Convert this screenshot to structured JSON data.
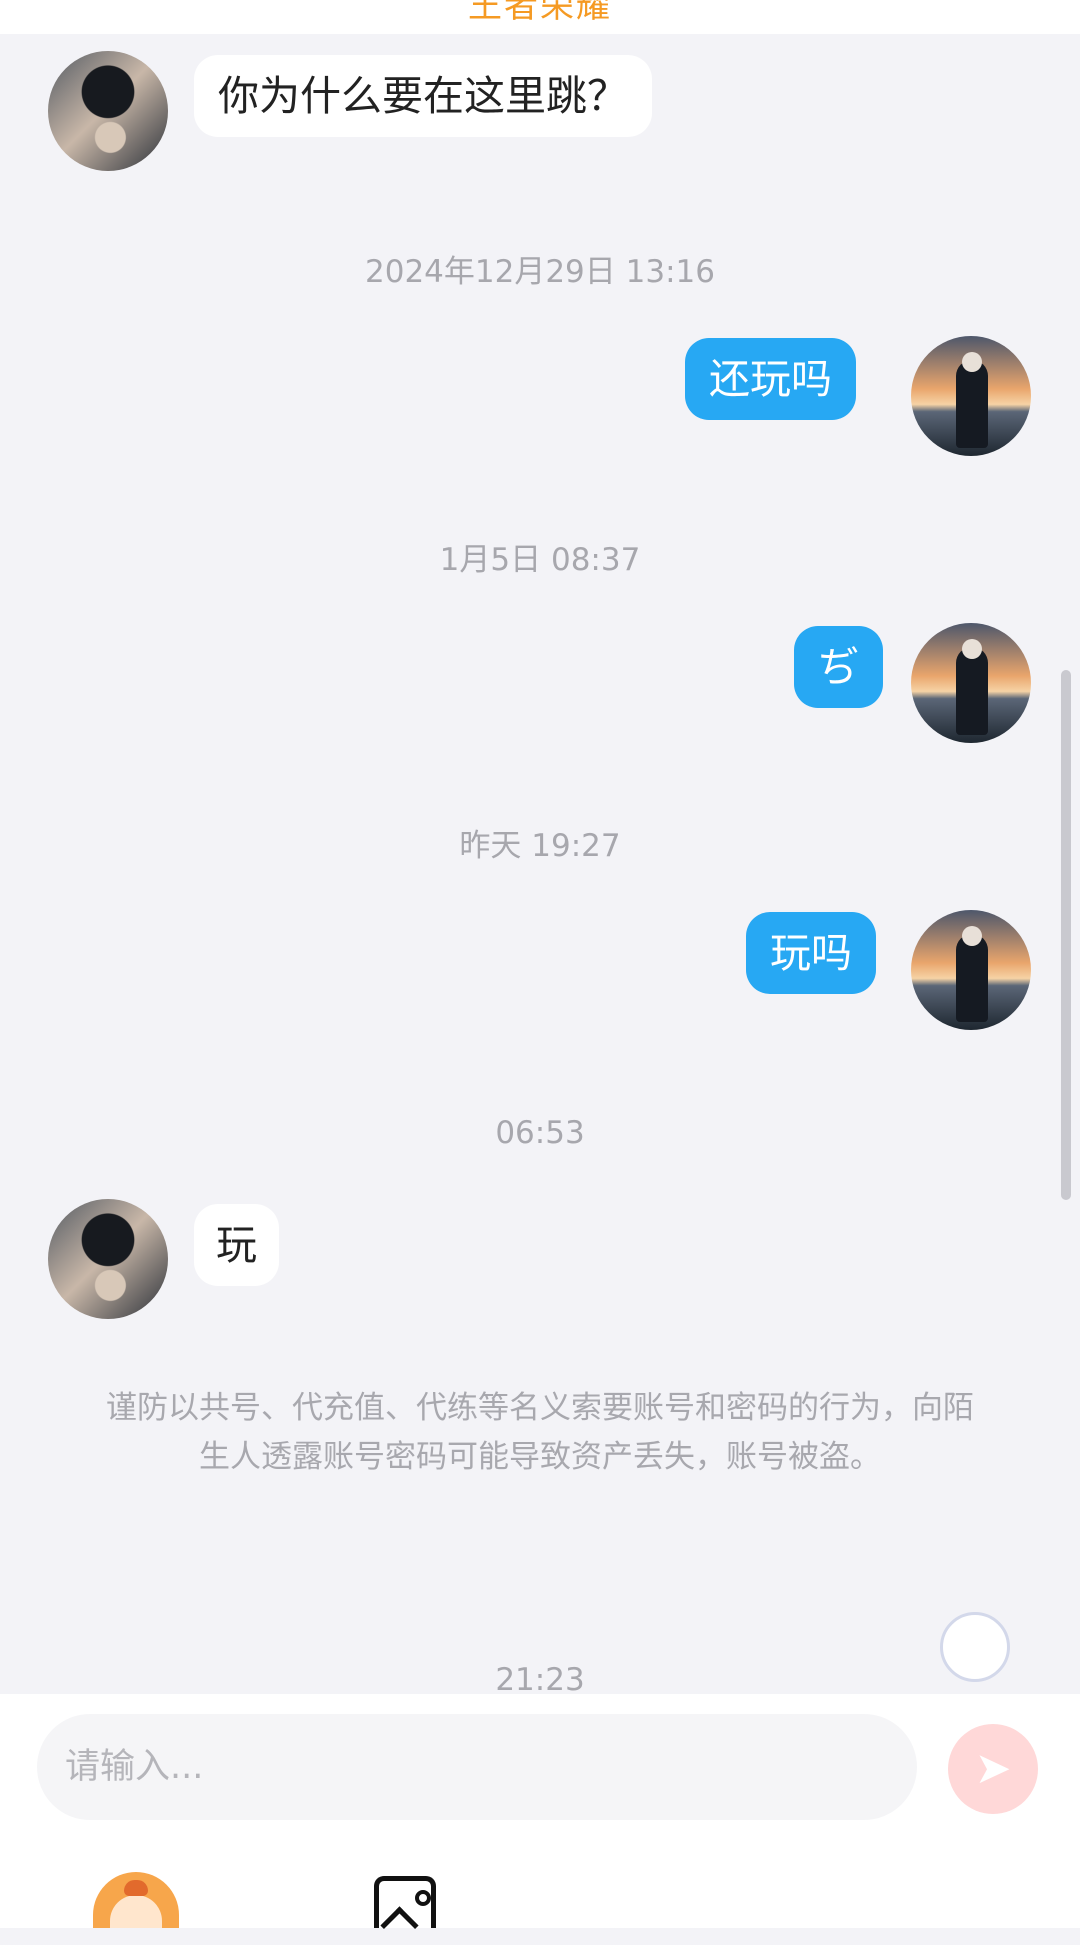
{
  "header": {
    "partial_title": "王者荣耀"
  },
  "messages": [
    {
      "side": "other",
      "text": "你为什么要在这里跳？"
    },
    {
      "time": "2024年12月29日 13:16"
    },
    {
      "side": "self",
      "text": "还玩吗"
    },
    {
      "time": "1月5日 08:37"
    },
    {
      "side": "self",
      "text": "ぢ"
    },
    {
      "time": "昨天 19:27"
    },
    {
      "side": "self",
      "text": "玩吗"
    },
    {
      "time": "06:53"
    },
    {
      "side": "other",
      "text": "玩"
    },
    {
      "notice": "谨防以共号、代充值、代练等名义索要账号和密码的行为，向陌生人透露账号密码可能导致资产丢失，账号被盗。"
    },
    {
      "time": "21:23"
    }
  ],
  "composer": {
    "placeholder": "请输入...",
    "send_icon": "paper-plane-icon",
    "tools": [
      "mascot-icon",
      "image-icon"
    ]
  },
  "colors": {
    "background": "#f3f3f7",
    "self_bubble": "#27a8f3",
    "other_bubble": "#ffffff",
    "header_accent": "#f59a23"
  }
}
